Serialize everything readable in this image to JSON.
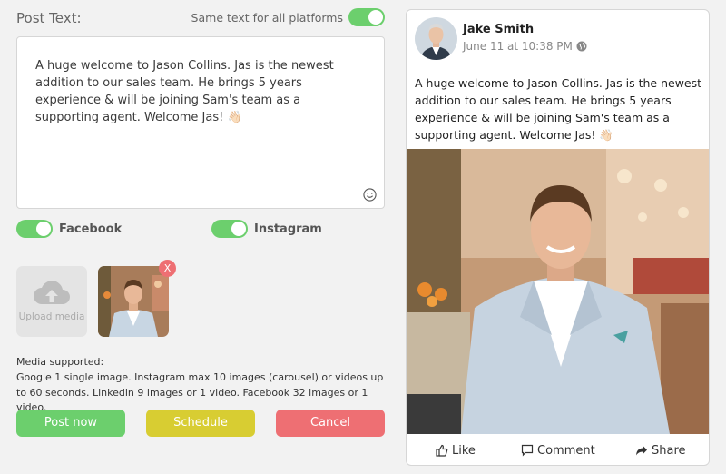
{
  "composer": {
    "post_text_label": "Post Text:",
    "same_text_label": "Same text for all platforms",
    "same_text_enabled": true,
    "text": "A huge welcome to Jason Collins. Jas is the newest addition to our sales team. He brings 5 years experience & will be joining Sam's team as a supporting agent. Welcome Jas! 👋🏻",
    "emoji_icon": "smiley-icon"
  },
  "platforms": [
    {
      "label": "Facebook",
      "enabled": true
    },
    {
      "label": "Instagram",
      "enabled": true
    }
  ],
  "media": {
    "upload_label": "Upload media",
    "remove_label": "X",
    "supported_title": "Media supported:",
    "supported_text": "Google 1 single image. Instagram max 10 images (carousel) or videos up to 60 seconds. Linkedin 9 images or 1 video. Facebook 32 images or 1 video."
  },
  "buttons": {
    "post_now": "Post now",
    "schedule": "Schedule",
    "cancel": "Cancel"
  },
  "preview": {
    "author": "Jake Smith",
    "timestamp": "June 11 at 10:38 PM",
    "text": "A huge welcome to Jason Collins. Jas is the newest addition to our sales team. He brings 5 years experience & will be joining Sam's team as a supporting agent. Welcome Jas! 👋🏻",
    "actions": {
      "like": "Like",
      "comment": "Comment",
      "share": "Share"
    }
  },
  "colors": {
    "green": "#6ccf6d",
    "yellow": "#d8cd32",
    "red": "#ee6f73"
  }
}
